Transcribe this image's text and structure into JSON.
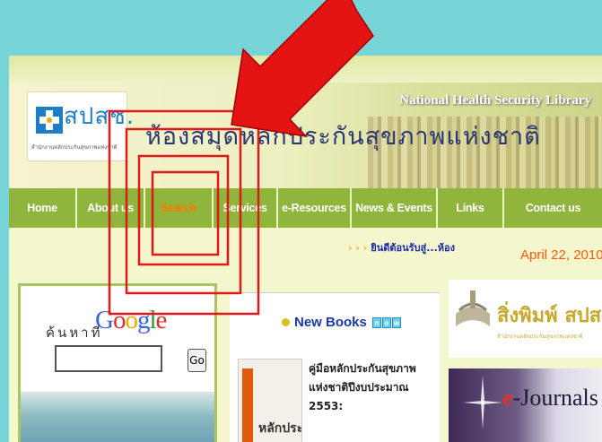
{
  "colors": {
    "background": "#77d5d8",
    "nav_green": "#8fb53c",
    "nav_active": "#ff7a00",
    "annotation_red": "#e01818",
    "date_orange": "#ff5a00"
  },
  "header": {
    "logo_text": "สปสช.",
    "logo_subtitle": "สำนักงานหลักประกันสุขภาพแห่งชาติ",
    "library_name_en": "National Health Security Library",
    "library_name_th": "ห้องสมุดหลักประกันสุขภาพแห่งชาติ",
    "logo_icon": "cross-logo-icon"
  },
  "nav": {
    "items": [
      {
        "label": "Home"
      },
      {
        "label": "About us"
      },
      {
        "label": "Search",
        "active": true
      },
      {
        "label": "Services"
      },
      {
        "label": "e-Resources"
      },
      {
        "label": "News & Events"
      },
      {
        "label": "Links"
      },
      {
        "label": "Contact us"
      }
    ]
  },
  "ticker": {
    "arrows": "› › ›",
    "text": "ยินดีต้อนรับสู่...ห้อง"
  },
  "date": "April 22, 2010",
  "search": {
    "label": "ค้นหาที่",
    "google_letters": [
      "G",
      "o",
      "o",
      "g",
      "l",
      "e"
    ],
    "google_colors": [
      "#3a64d8",
      "#d8302a",
      "#e8b000",
      "#3a64d8",
      "#2a9a3a",
      "#d8302a"
    ],
    "input_value": "",
    "go_label": "Go"
  },
  "new_books": {
    "heading": "New Books",
    "badge_letters": [
      "n",
      "e",
      "w"
    ],
    "book_title": "คู่มือหลักประกันสุขภาพแห่งชาติปีงบประมาณ 2553:",
    "book_cover_text": "หลักประกัน"
  },
  "sidebar_right": {
    "publications_title": "สิ่งพิมพ์ สปสช.",
    "publications_subtitle": "สำนักงานหลักประกันสุขภาพแห่งชาติ",
    "ejournals_e": "e",
    "ejournals_rest": "-Journals"
  },
  "annotation": {
    "type": "red arrow with concentric red rectangles highlighting the Search menu item",
    "icon": "red-arrow-icon"
  }
}
